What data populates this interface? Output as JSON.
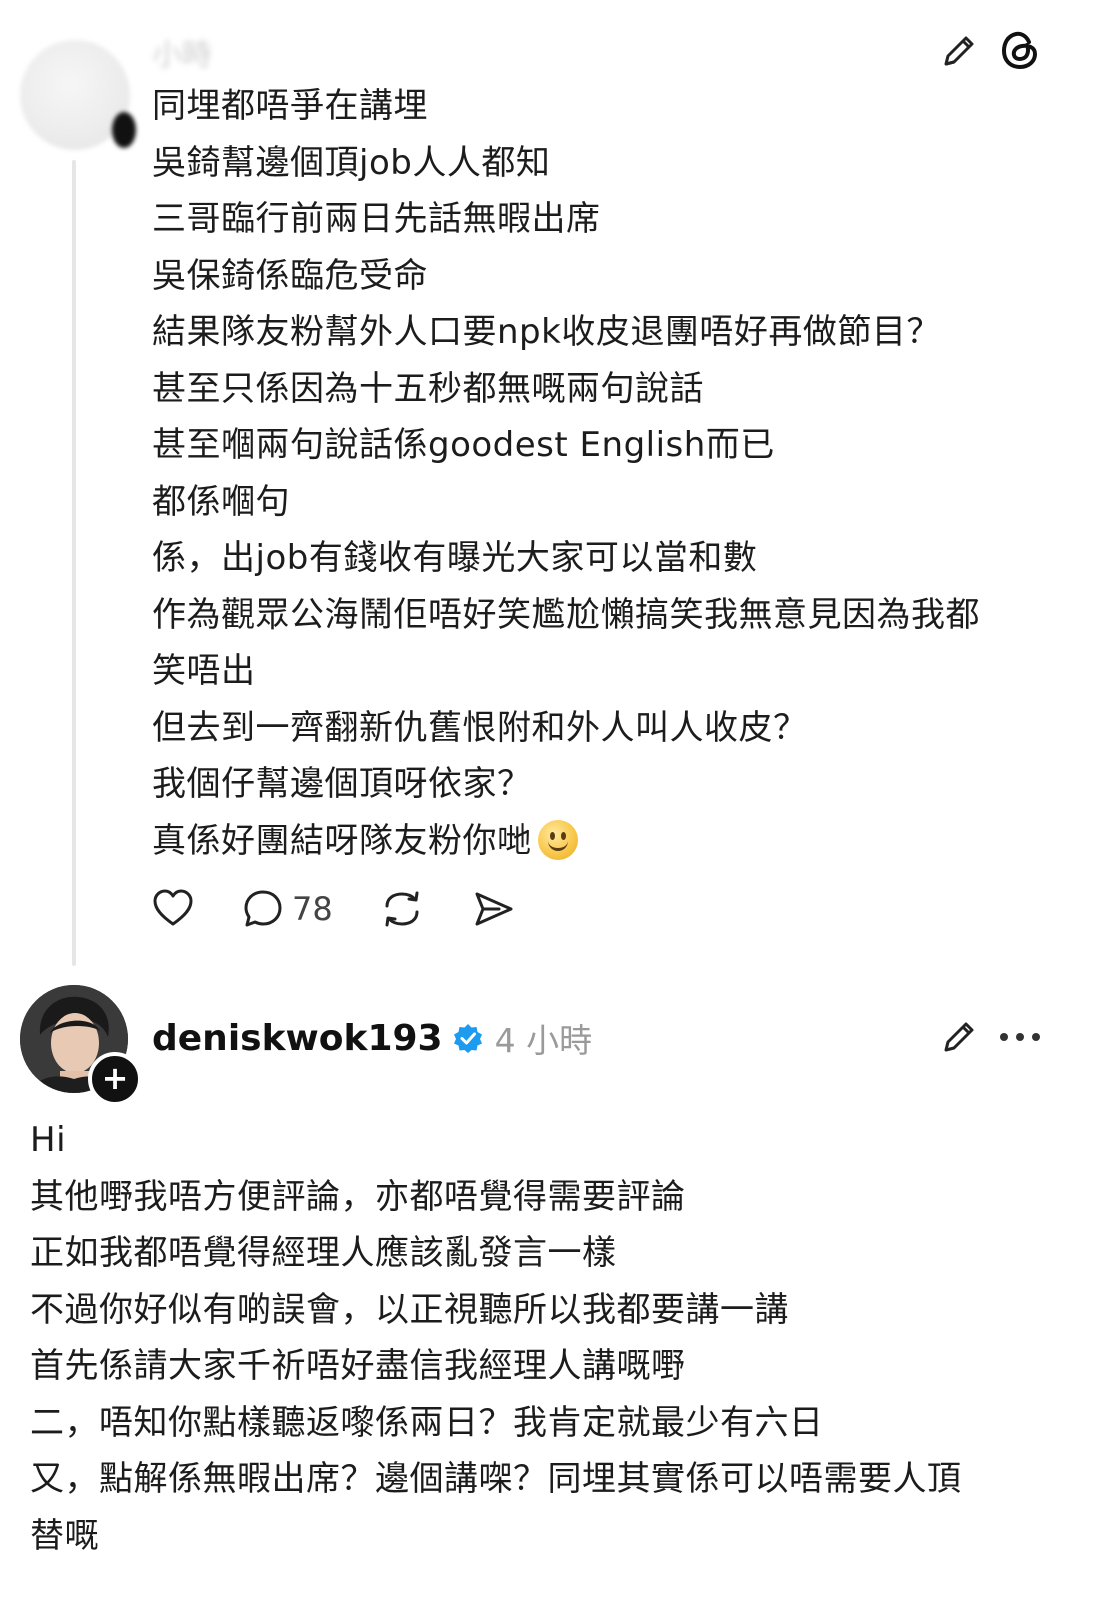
{
  "post1": {
    "header_time": "小時",
    "lines": [
      "同埋都唔爭在講埋",
      "吳錡幫邊個頂job人人都知",
      "三哥臨行前兩日先話無暇出席",
      "吳保錡係臨危受命",
      "結果隊友粉幫外人口要npk收皮退團唔好再做節目？",
      "甚至只係因為十五秒都無嘅兩句說話",
      "甚至嗰兩句說話係goodest English而已",
      "都係嗰句",
      "係，出job有錢收有曝光大家可以當和數",
      "作為觀眾公海鬧佢唔好笑尷尬懶搞笑我無意見因為我都",
      "笑唔出",
      "但去到一齊翻新仇舊恨附和外人叫人收皮？",
      "我個仔幫邊個頂呀依家？",
      "真係好團結呀隊友粉你哋"
    ],
    "reply_count": "78"
  },
  "icons": {
    "edit": "edit-pencil-icon",
    "logo": "threads-logo-icon",
    "like": "heart-icon",
    "reply": "comment-bubble-icon",
    "repost": "repost-icon",
    "share": "send-icon",
    "more": "more-dots-icon",
    "verified": "verified-badge-icon",
    "emoji": "slightly-smiling-face-emoji"
  },
  "post2": {
    "username": "deniskwok193",
    "time": "4 小時",
    "follow_symbol": "+",
    "lines": [
      "Hi",
      "其他嘢我唔方便評論，亦都唔覺得需要評論",
      "正如我都唔覺得經理人應該亂發言一樣",
      "不過你好似有啲誤會，以正視聽所以我都要講一講",
      "首先係請大家千祈唔好盡信我經理人講嘅嘢",
      "二，唔知你點樣聽返嚟係兩日？我肯定就最少有六日",
      "又，點解係無暇出席？邊個講㗎？同埋其實係可以唔需要人頂",
      "替嘅"
    ]
  },
  "colors": {
    "verified": "#1d9bf0",
    "thread_line": "#e6e6e6",
    "muted_text": "#9a9a9a"
  }
}
